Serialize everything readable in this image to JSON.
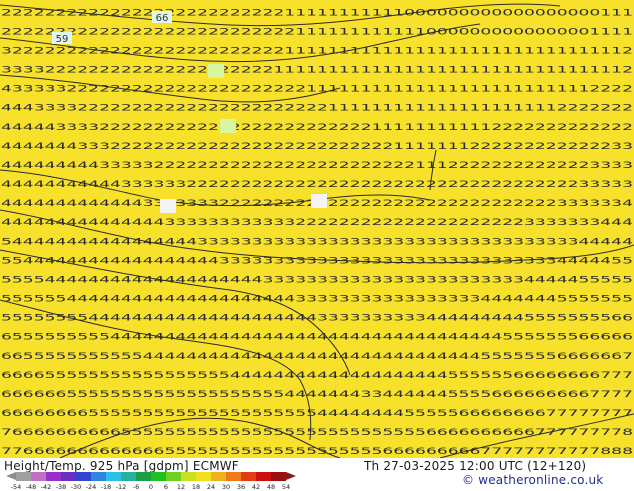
{
  "map": {
    "background": "#f7e12a",
    "background_light": "#fbe92e",
    "contour_labels": [
      "66",
      "59"
    ],
    "grid_values": {
      "rows": [
        "2222222222222222222222222211111111111000000000000000000111",
        "2222222222222222222222222221111111111110000000000000001111",
        "3222222222222222222222222211111111111111111111111111111112",
        "3333222222222222222222222111111111111111111111111111111112",
        "4333332222222222222222222222111111111111111111111111112222",
        "4443333222222222222222222222221111111111111111111112222222",
        "4444433332222222222222222222222222111111111112222222222222",
        "4444444333222222222222222222222222221111111222222222222233",
        "4444444443333322222222222222222222222211122222222222223333",
        "4444444444433333322222222222222222222222222222222222233333",
        "4444444444444333333322222222222222222222222222222223333334",
        "4444444444444443333333333332222222222222222222223333333444",
        "5444444444444444443333333333333333333333333333333333344444",
        "5544444444444444444433333333333333333333333333333334444455",
        "5555444444444444444444443333333333333333333333334444455555",
        "5555554444444444444444444443333333333333333344444445555555",
        "5555555544444444444444444444433333333334444444445555555566",
        "6555555555444444444444444444444444444444444444555555566666",
        "6655555555555444444444444444444444444444444455555556666667",
        "6666555555555555555554444444444444444444455555566666666777",
        "6666665555555555555555555544444443344444455556666666667777",
        "6666666655555555555555555555544444444555556666666677777777",
        "7666666666655555555555555555555555555556666666666777777778",
        "7766666666666665555555555555555555566666666677777777777888"
      ]
    }
  },
  "info": {
    "left_label": "Height/Temp. 925 hPa [gdpm] ECMWF",
    "right_label": "Th 27-03-2025 12:00 UTC (12+120)",
    "credit": "© weatheronline.co.uk"
  },
  "scale": {
    "ticks": [
      "-54",
      "-48",
      "-42",
      "-38",
      "-30",
      "-24",
      "-18",
      "-12",
      "-6",
      "0",
      "6",
      "12",
      "18",
      "24",
      "30",
      "36",
      "42",
      "48",
      "54"
    ],
    "colors": [
      "#a0a0a0",
      "#c070c0",
      "#9b30c8",
      "#6a2fc0",
      "#3344d0",
      "#2f84e0",
      "#2cc0e8",
      "#25b0a0",
      "#1fa040",
      "#20c020",
      "#70d020",
      "#c8e020",
      "#f0e020",
      "#f0b020",
      "#ee7a1a",
      "#e23c14",
      "#c81010",
      "#9a0f0f"
    ]
  }
}
